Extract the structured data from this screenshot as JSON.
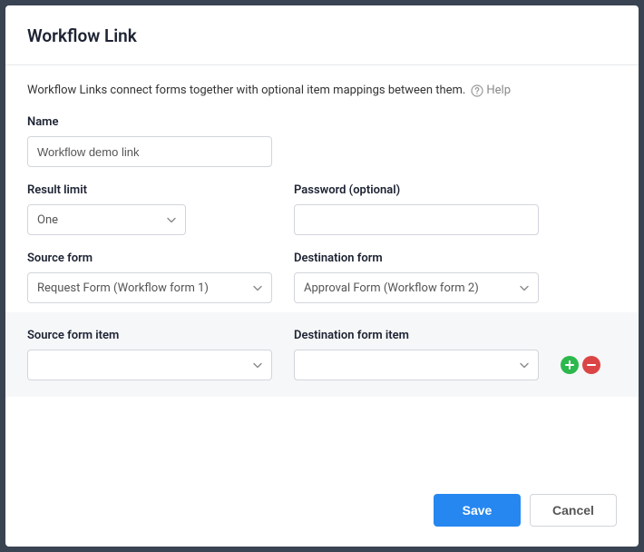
{
  "modal": {
    "title": "Workflow Link",
    "description": "Workflow Links connect forms together with optional item mappings between them.",
    "help_label": "Help"
  },
  "labels": {
    "name": "Name",
    "result_limit": "Result limit",
    "password": "Password (optional)",
    "source_form": "Source form",
    "destination_form": "Destination form",
    "source_form_item": "Source form item",
    "destination_form_item": "Destination form item"
  },
  "values": {
    "name": "Workflow demo link",
    "result_limit": "One",
    "password": "",
    "source_form": "Request Form (Workflow form 1)",
    "destination_form": "Approval Form (Workflow form 2)",
    "source_form_item": "",
    "destination_form_item": ""
  },
  "footer": {
    "save": "Save",
    "cancel": "Cancel"
  }
}
